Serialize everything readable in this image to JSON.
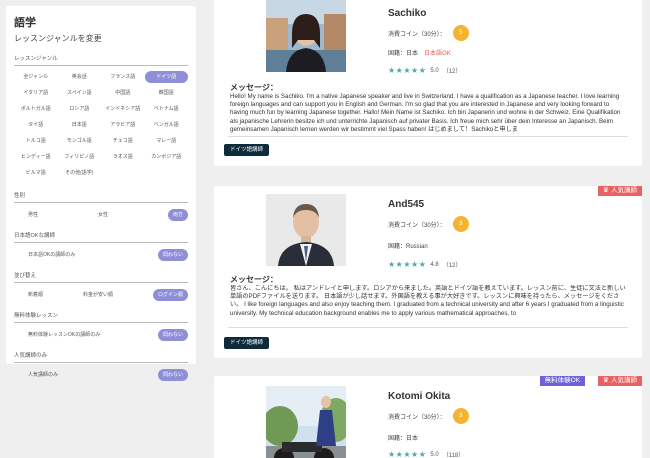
{
  "sidebar": {
    "title": "語学",
    "change_link": "レッスンジャンルを変更",
    "genre_label": "レッスンジャンル",
    "languages": [
      {
        "label": "全ジャンル",
        "selected": false
      },
      {
        "label": "英会話",
        "selected": false
      },
      {
        "label": "フランス語",
        "selected": false
      },
      {
        "label": "ドイツ語",
        "selected": true
      },
      {
        "label": "イタリア語",
        "selected": false
      },
      {
        "label": "スペイン語",
        "selected": false
      },
      {
        "label": "中国語",
        "selected": false
      },
      {
        "label": "韓国語",
        "selected": false
      },
      {
        "label": "ポルトガル語",
        "selected": false
      },
      {
        "label": "ロシア語",
        "selected": false
      },
      {
        "label": "インドネシア語",
        "selected": false
      },
      {
        "label": "ベトナム語",
        "selected": false
      },
      {
        "label": "タイ語",
        "selected": false
      },
      {
        "label": "日本語",
        "selected": false
      },
      {
        "label": "アラビア語",
        "selected": false
      },
      {
        "label": "ベンガル語",
        "selected": false
      },
      {
        "label": "トルコ語",
        "selected": false
      },
      {
        "label": "モンゴル語",
        "selected": false
      },
      {
        "label": "チェコ語",
        "selected": false
      },
      {
        "label": "マレー語",
        "selected": false
      },
      {
        "label": "ヒンディー語",
        "selected": false
      },
      {
        "label": "フィリピノ語",
        "selected": false
      },
      {
        "label": "ラオス語",
        "selected": false
      },
      {
        "label": "カンボジア語",
        "selected": false
      },
      {
        "label": "ビルマ語",
        "selected": false
      },
      {
        "label": "その他(語学)",
        "selected": false
      }
    ],
    "gender": {
      "label": "性別",
      "male": "男性",
      "female": "女性",
      "both": "両方"
    },
    "japanese_ok": {
      "label": "日本語OKな講師",
      "option": "日本語OKの講師のみ",
      "button": "問わない"
    },
    "sort": {
      "label": "並び替え",
      "newest": "新着順",
      "cheapest": "料金が安い順",
      "login": "ログイン順"
    },
    "free_trial": {
      "label": "無料体験レッスン",
      "option": "無料体験レッスンOKの講師のみ",
      "button": "問わない"
    },
    "popular": {
      "label": "人気講師のみ",
      "option": "人気講師のみ",
      "button": "問わない"
    }
  },
  "common": {
    "coin_label": "消費コイン（30分）：",
    "country_prefix": "国籍：",
    "message_heading": "メッセージ：",
    "teacher_tag": "ドイツ語講師",
    "popular_badge": "人気講師",
    "trial_badge": "無料体験OK",
    "stars": "★★★★★"
  },
  "teachers": [
    {
      "name": "Sachiko",
      "coins": "5",
      "country": "日本",
      "japanese_ok": "日本語OK",
      "rating": "5.0",
      "reviews": "（12）",
      "message": "Hello! My name is Sachiko. I'm a native Japanese speaker and live in Switzerland. I have a qualification as a Japanese teacher. I love learning foreign languages and can support you in English and German. I'm so glad that you are interested in Japanese and very looking forward to having much fun by learning Japanese together. Hallo! Mein Name ist Sachiko. Ich bin Japanerin und wohne in der Schweiz. Eine Qualifikation als japanische Lehrerin besitze ich und unterrichte Japanisch auf privater Basis. Ich freue mich sehr über dein Interesse an Japanisch. Beim gemeinsamen Japanisch lernen werden wir bestimmt viel Spass haben! はじめまして！Sachikoと申しま"
    },
    {
      "name": "And545",
      "coins": "3",
      "country": "Russian",
      "rating": "4.8",
      "reviews": "（12）",
      "message": "皆さん、こんにちは。 私はアンドレイと申します。ロシアから来ました。英語とドイツ語を教えています。レッスン前に、生徒に文法と新しい単語のPDFファイルを送ります。 日本語が少し話せます。外国語を教える事が大好きです。レッスンに興味を持ったら、メッセージをください。 I like foreign languages and also enjoy teaching them. I graduated from a technical university and after 6 years I graduated from a linguistic university. My technical education background enables me to apply various mathematical approaches, to"
    },
    {
      "name": "Kotomi Okita",
      "coins": "3",
      "country": "日本",
      "rating": "5.0",
      "reviews": "（118）"
    }
  ]
}
